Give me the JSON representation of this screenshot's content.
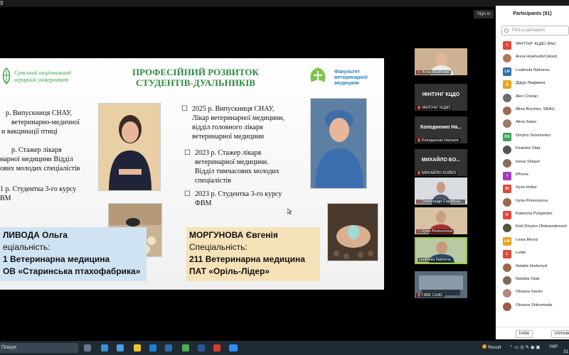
{
  "window": {
    "tab_number": "9",
    "sign_in": "Sign in"
  },
  "slide": {
    "left_logo_text": [
      "Сумський національний",
      "аграрний університет"
    ],
    "title_lines": [
      "ПРОФЕСІЙНИЙ РОЗВИТОК",
      "СТУДЕНТІВ-ДУАЛЬНИКІВ"
    ],
    "right_logo_text": [
      "Факультет",
      "ветеринарної",
      "медицини"
    ],
    "left_lines": [
      "р. Випускниця СНАУ,",
      "ветеринарно-медичної",
      "и вакцинації птиці",
      "р. Стажер лікаря",
      "нарної медицини Відділ",
      "ових молодих спеціалістів",
      "1 р. Студентка 3-го курсу",
      "ВМ"
    ],
    "right_items": [
      {
        "lines": [
          "2025 р. Випускниця СНАУ,",
          "Лікар ветеринарної медицини,",
          "відділ головного лікаря",
          "ветеринарної медицини"
        ]
      },
      {
        "lines": [
          "2023 р. Стажер лікаря",
          "ветеринарної медицини.",
          "Відділ тимчасових молодих",
          "спеціалістів"
        ]
      },
      {
        "lines": [
          "2023 р. Студентка 3-го курсу",
          "ФВМ"
        ]
      }
    ],
    "left_box": [
      "ЛИВОДА Ольга",
      "еціальність:",
      "1 Ветеринарна медицина",
      "ОВ «Старинська птахофабрика»"
    ],
    "right_box": [
      "МОРГУНОВА Євгенія",
      "Спеціальність:",
      "211 Ветеринарна медицина",
      "ПАТ «Оріль-Лідер»"
    ]
  },
  "video_tiles": [
    {
      "name": "Anna Hlukhodid",
      "type": "video"
    },
    {
      "name": "ІФНТУНГ КЦДО",
      "type": "name"
    },
    {
      "name": "Колодненко На...",
      "caption": "Колодненко Наталія",
      "type": "name"
    },
    {
      "name": "МИХАЙЛО БО...",
      "caption": "МИХАЙЛО БОЙКО",
      "type": "name"
    },
    {
      "name": "Олександр Сарабськ...",
      "type": "video"
    },
    {
      "name": "Iryna Perevozova",
      "type": "video"
    },
    {
      "name": "Liudmula Nahorna",
      "type": "video"
    },
    {
      "name": "ГАВК СНАУ",
      "type": "video"
    }
  ],
  "participants": {
    "title": "Participants (91)",
    "search_placeholder": "Find a participant",
    "items": [
      {
        "initials": "I",
        "name": "ІФНТУНГ КЦДО (Me)",
        "color": "#e0483a"
      },
      {
        "initials": "",
        "name": "Anna Hlukhodid (Host)",
        "color": "#b07a5a"
      },
      {
        "initials": "LN",
        "name": "Liudmula Nahorna",
        "color": "#2e6fa8"
      },
      {
        "initials": "Д",
        "name": "Дідур Людмила",
        "color": "#e8a21a"
      },
      {
        "initials": "",
        "name": "Alex Chelan",
        "color": "#6b6b6b"
      },
      {
        "initials": "",
        "name": "Alina Brychko, SNAU",
        "color": "#a06a50"
      },
      {
        "initials": "",
        "name": "Alina Salun",
        "color": "#9a7b6a"
      },
      {
        "initials": "DS",
        "name": "Dmytro Solomonko",
        "color": "#3aa357"
      },
      {
        "initials": "",
        "name": "Fedorko Vlad",
        "color": "#555"
      },
      {
        "initials": "",
        "name": "Inesa Shepel",
        "color": "#8a6b5a"
      },
      {
        "initials": "I",
        "name": "iPhone",
        "color": "#a23cc4"
      },
      {
        "initials": "IH",
        "name": "Iryna Hobyr",
        "color": "#e0483a"
      },
      {
        "initials": "",
        "name": "Iryna Perevozova",
        "color": "#9a6a4a"
      },
      {
        "initials": "K",
        "name": "Kateryna Pylypenko",
        "color": "#e0483a"
      },
      {
        "initials": "",
        "name": "Kisil Dmytro Oleksandrovich",
        "color": "#4a5a3a"
      },
      {
        "initials": "LM",
        "name": "Lesia Moroz",
        "color": "#e8a21a"
      },
      {
        "initials": "L",
        "name": "Lutak",
        "color": "#e0483a"
      },
      {
        "initials": "",
        "name": "Natalie Hrebenyk",
        "color": "#9a6a4a"
      },
      {
        "initials": "",
        "name": "Nataliia Opar",
        "color": "#7a6a5a"
      },
      {
        "initials": "",
        "name": "Oksana Savko",
        "color": "#b08a7a"
      },
      {
        "initials": "",
        "name": "Oksana Shkromada",
        "color": "#9a5a4a"
      }
    ],
    "invite_label": "Invite",
    "mute_label": "Unmute"
  },
  "taskbar": {
    "search_text": "Пошук",
    "result_label": "Result",
    "lang": "УКР",
    "time": "31"
  },
  "colors": {
    "slide_green": "#2e8b3e",
    "box_blue": "#cfe3f3",
    "box_yellow": "#f6e2b8",
    "muted_red": "#e74c3c"
  }
}
